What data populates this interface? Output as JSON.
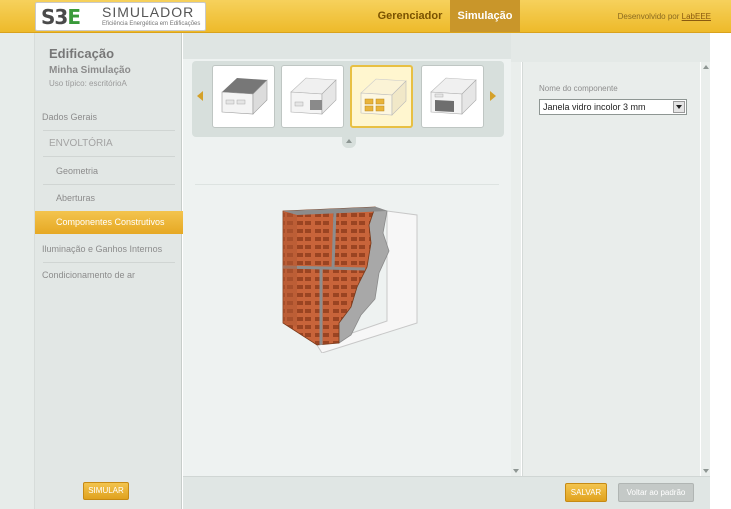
{
  "header": {
    "logo_mark_main": "S3",
    "logo_mark_e": "E",
    "logo_title": "SIMULADOR",
    "logo_subtitle": "Eficiência Energética em Edificações",
    "nav": [
      {
        "label": "Gerenciador",
        "active": false
      },
      {
        "label": "Simulação",
        "active": true
      }
    ],
    "developed_by": "Desenvolvido por",
    "developer_link": "LabEEE"
  },
  "sidebar": {
    "title": "Edificação",
    "simulation_name": "Minha Simulação",
    "usage_type": "Uso típico: escritórioA",
    "items": [
      {
        "label": "Dados Gerais",
        "level": 0
      },
      {
        "label": "ENVOLTÓRIA",
        "level": 0
      },
      {
        "label": "Geometria",
        "level": 1
      },
      {
        "label": "Aberturas",
        "level": 1
      },
      {
        "label": "Componentes Construtivos",
        "level": 1,
        "active": true
      },
      {
        "label": "Iluminação e Ganhos Internos",
        "level": 0
      },
      {
        "label": "Condicionamento de ar",
        "level": 0
      }
    ],
    "simulate_button": "SIMULAR"
  },
  "carousel": {
    "thumbnails": [
      {
        "icon": "roof-component-icon",
        "selected": false
      },
      {
        "icon": "floor-component-icon",
        "selected": false
      },
      {
        "icon": "window-component-icon",
        "selected": true
      },
      {
        "icon": "wall-component-icon",
        "selected": false
      }
    ]
  },
  "preview": {
    "icon": "brick-wall-section-icon"
  },
  "component": {
    "label": "Nome do componente",
    "selected_value": "Janela vidro incolor 3 mm"
  },
  "footer": {
    "save_button": "SALVAR",
    "reset_button": "Voltar ao padrão"
  },
  "colors": {
    "accent": "#eeba2a",
    "accent_dark": "#c9962a",
    "panel_bg": "#e2e7e5",
    "brick": "#c8643a"
  }
}
